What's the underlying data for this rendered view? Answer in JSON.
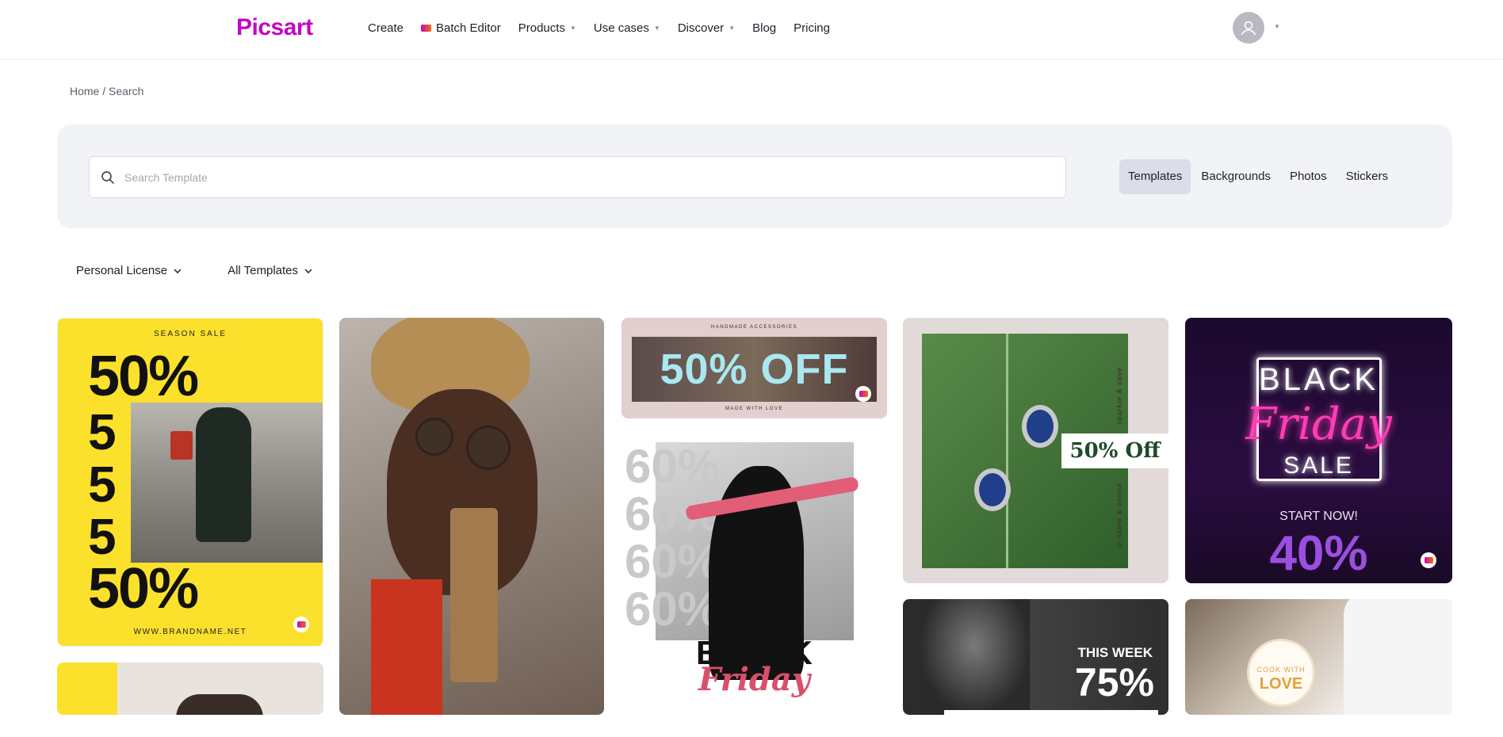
{
  "header": {
    "logo": "Picsart",
    "nav": [
      {
        "label": "Create",
        "icon": null,
        "caret": false
      },
      {
        "label": "Batch Editor",
        "icon": "batch-editor-icon",
        "caret": false
      },
      {
        "label": "Products",
        "icon": null,
        "caret": true
      },
      {
        "label": "Use cases",
        "icon": null,
        "caret": true
      },
      {
        "label": "Discover",
        "icon": null,
        "caret": true
      },
      {
        "label": "Blog",
        "icon": null,
        "caret": false
      },
      {
        "label": "Pricing",
        "icon": null,
        "caret": false
      }
    ]
  },
  "breadcrumb": "Home / Search",
  "search": {
    "placeholder": "Search Template",
    "value": "",
    "tabs": [
      "Templates",
      "Backgrounds",
      "Photos",
      "Stickers"
    ],
    "active_tab": "Templates"
  },
  "filters": {
    "license": "Personal License",
    "type": "All Templates"
  },
  "cards": {
    "c1": {
      "top": "SEASON SALE",
      "big": "50%",
      "fives": [
        "5",
        "5",
        "5"
      ],
      "big2": "50%",
      "url": "WWW.BRANDNAME.NET"
    },
    "c3": {
      "top": "HANDMADE ACCESSORIES",
      "big": "50% OFF",
      "bottom": "MADE WITH LOVE"
    },
    "c4": {
      "pct": [
        "60%",
        "60%",
        "60%",
        "60%"
      ],
      "line1": "BLACK",
      "line2": "Friday"
    },
    "c5": {
      "offer": "50% Off",
      "side1": "sparkle & save",
      "side2": "in-store & online"
    },
    "c6": {
      "line1": "BLACK",
      "line2": "Friday",
      "line3": "SALE",
      "cta": "START NOW!",
      "pct": "40%"
    },
    "c7": {
      "label": "THIS WEEK",
      "pct": "75%"
    },
    "c8": {
      "line1": "COOK WITH",
      "line2": "LOVE"
    }
  },
  "colors": {
    "brand": "#c209c1",
    "panel": "#f2f3f7",
    "active_tab": "#dcdde6"
  }
}
